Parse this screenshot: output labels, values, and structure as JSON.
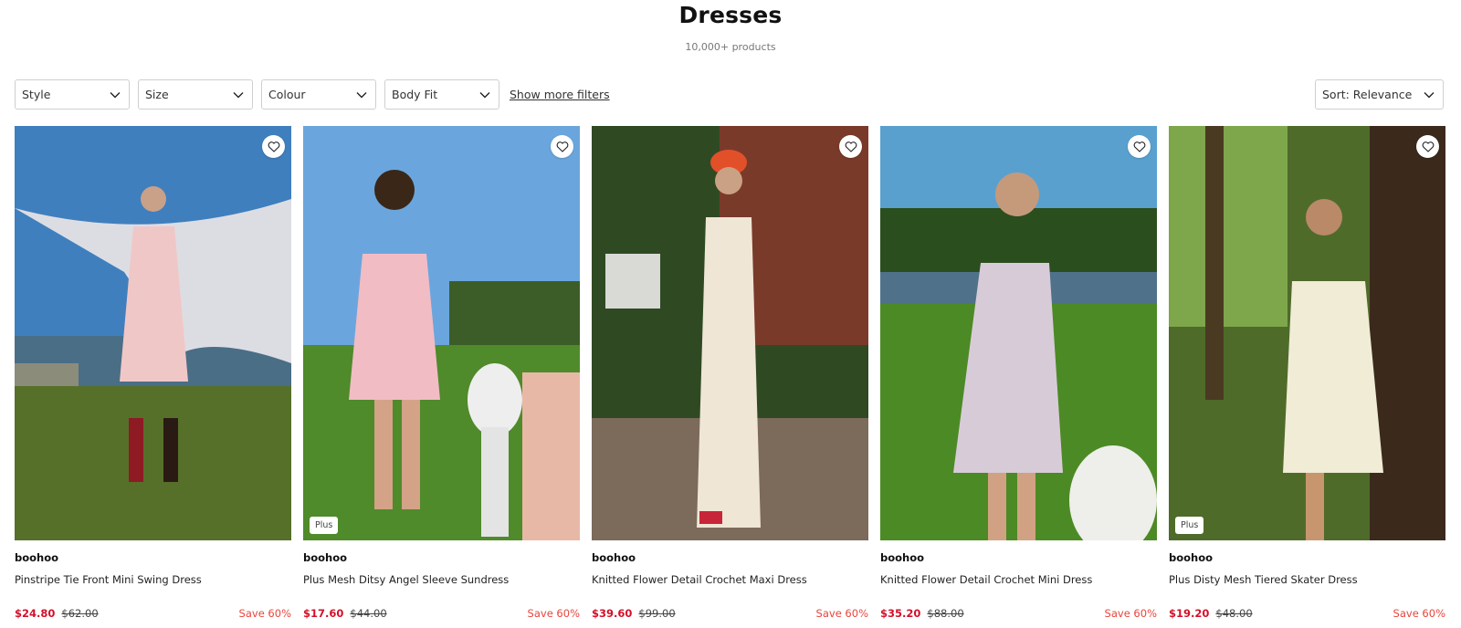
{
  "page": {
    "title": "Dresses",
    "count": "10,000+ products"
  },
  "filters": [
    "Style",
    "Size",
    "Colour",
    "Body Fit"
  ],
  "more_filters": "Show more filters",
  "sort": "Sort: Relevance",
  "products": [
    {
      "brand": "boohoo",
      "name": "Pinstripe Tie Front Mini Swing Dress",
      "price": "$24.80",
      "was": "$62.00",
      "save": "Save 60%",
      "badge": ""
    },
    {
      "brand": "boohoo",
      "name": "Plus Mesh Ditsy Angel Sleeve Sundress",
      "price": "$17.60",
      "was": "$44.00",
      "save": "Save 60%",
      "badge": "Plus"
    },
    {
      "brand": "boohoo",
      "name": "Knitted Flower Detail Crochet Maxi Dress",
      "price": "$39.60",
      "was": "$99.00",
      "save": "Save 60%",
      "badge": ""
    },
    {
      "brand": "boohoo",
      "name": "Knitted Flower Detail Crochet Mini Dress",
      "price": "$35.20",
      "was": "$88.00",
      "save": "Save 60%",
      "badge": ""
    },
    {
      "brand": "boohoo",
      "name": "Plus Disty Mesh Tiered Skater Dress",
      "price": "$19.20",
      "was": "$48.00",
      "save": "Save 60%",
      "badge": "Plus"
    }
  ],
  "colors": {
    "sale_price": "#d3102a",
    "save_text": "#e8453c",
    "border": "#cfcfcf"
  },
  "icons": {
    "filter_chevron": "chevron-down-icon",
    "wishlist": "heart-icon"
  }
}
